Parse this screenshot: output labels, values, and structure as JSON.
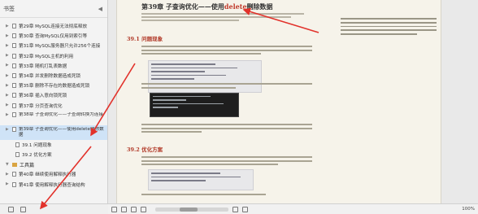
{
  "sidebar": {
    "header": "书签",
    "items": [
      {
        "label": "第29章  MySQL连接无法彻底释放",
        "indent": 0,
        "caret": true
      },
      {
        "label": "第30章  查询MySQL仅用到索引等",
        "indent": 0,
        "caret": true
      },
      {
        "label": "第31章  MySQL服务器只允许256个连接",
        "indent": 0,
        "caret": true
      },
      {
        "label": "第32章  MySQL主机的利用",
        "indent": 0,
        "caret": true
      },
      {
        "label": "第33章  随机打乱表数据",
        "indent": 0,
        "caret": true
      },
      {
        "label": "第34章  并发删除数据造成死锁",
        "indent": 0,
        "caret": true
      },
      {
        "label": "第35章  删除不存在的数据造成死锁",
        "indent": 0,
        "caret": true
      },
      {
        "label": "第36章  插入意向锁死锁",
        "indent": 0,
        "caret": true
      },
      {
        "label": "第37章  分页查询优化",
        "indent": 0,
        "caret": true
      },
      {
        "label": "第38章  子查询优化——子查询转换为连接",
        "indent": 0,
        "caret": true,
        "multi": true
      },
      {
        "label": "第39章  子查询优化——使用delete删除数据",
        "indent": 0,
        "caret": true,
        "multi": true,
        "active": true
      },
      {
        "label": "39.1  问题现象",
        "indent": 1
      },
      {
        "label": "39.2  优化方案",
        "indent": 1
      },
      {
        "label": "工具篇",
        "section": true
      },
      {
        "label": "第40章  继续使用解释执行器",
        "indent": 0,
        "caret": true
      },
      {
        "label": "第41章  使用解释执行器查询结构",
        "indent": 0,
        "caret": true
      }
    ]
  },
  "document": {
    "chapter_prefix": "第39章  子查询优化——使用",
    "chapter_highlight": "delete",
    "chapter_suffix": "删除数据",
    "section1": "39.1  问题现象",
    "section2": "39.2  优化方案"
  },
  "statusbar": {
    "zoom": "100%"
  },
  "colors": {
    "arrow": "#e2322b",
    "active_item": "#cfe3f7",
    "page": "#f6f3ea"
  }
}
